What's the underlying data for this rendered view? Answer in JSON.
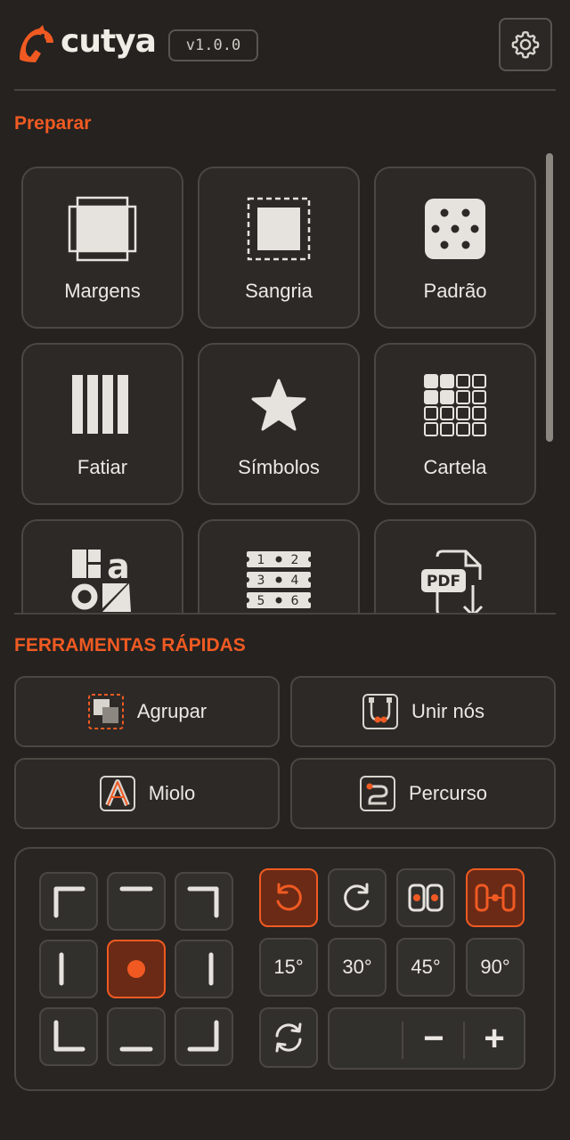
{
  "app": {
    "name": "cutya",
    "version": "v1.0.0"
  },
  "header": {
    "settings_icon": "gear-icon"
  },
  "colors": {
    "accent": "#f05a22",
    "background": "#252220",
    "tile": "#2c2927",
    "border": "#4b4742"
  },
  "prepare": {
    "title": "Preparar",
    "tools": [
      {
        "label": "Margens",
        "icon": "margins-icon"
      },
      {
        "label": "Sangria",
        "icon": "bleed-icon"
      },
      {
        "label": "Padrão",
        "icon": "pattern-dots-icon"
      },
      {
        "label": "Fatiar",
        "icon": "slice-columns-icon"
      },
      {
        "label": "Símbolos",
        "icon": "star-icon"
      },
      {
        "label": "Cartela",
        "icon": "sheet-grid-icon"
      },
      {
        "label": "",
        "icon": "shapes-letters-icon"
      },
      {
        "label": "",
        "icon": "numbered-labels-icon"
      },
      {
        "label": "",
        "icon": "pdf-export-icon"
      }
    ]
  },
  "quick_tools": {
    "title": "FERRAMENTAS RÁPIDAS",
    "buttons": [
      {
        "label": "Agrupar",
        "icon": "group-icon"
      },
      {
        "label": "Unir nós",
        "icon": "join-nodes-icon"
      },
      {
        "label": "Miolo",
        "icon": "letter-a-outline-icon"
      },
      {
        "label": "Percurso",
        "icon": "path-icon"
      }
    ]
  },
  "transform": {
    "anchor_selected": "center",
    "rotate_labels": [
      "15°",
      "30°",
      "45°",
      "90°"
    ],
    "stepper": {
      "value": "",
      "minus": "−",
      "plus": "+"
    }
  }
}
